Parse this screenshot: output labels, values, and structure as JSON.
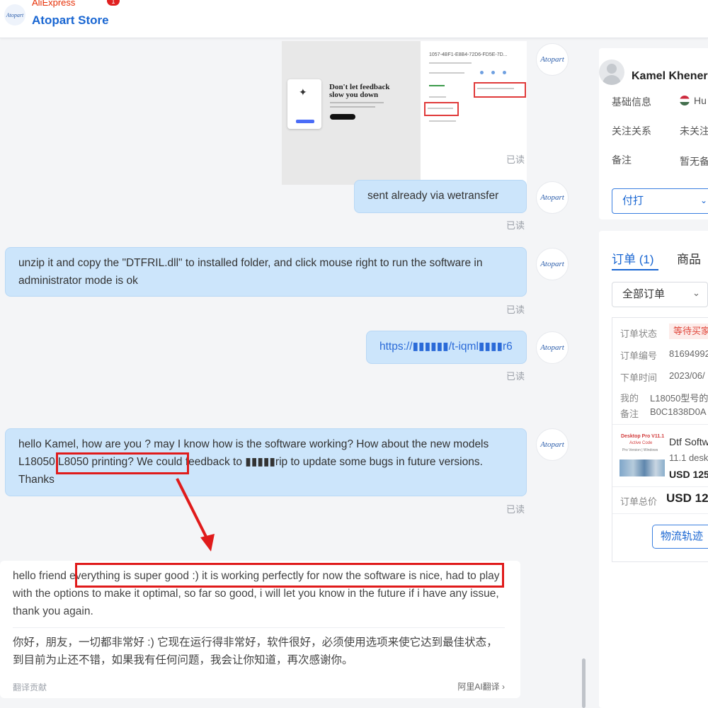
{
  "header": {
    "platform_label": "AliExpress",
    "store_name": "Atopart Store",
    "notification_count": "1",
    "store_logo_text": "Atopart"
  },
  "chat": {
    "agent_avatar_text": "Atopart",
    "read_label": "已读",
    "image_message": {
      "order_id_text": "1057-4BF1-E8B4-72D6-FD5E-7D...",
      "feedback_headline_1": "Don't let feedback",
      "feedback_headline_2": "slow you down"
    },
    "messages": [
      {
        "text": "sent already via wetransfer"
      },
      {
        "text": "unzip it and copy the \"DTFRIL.dll\" to installed folder, and click mouse right to run the software in administrator mode is ok"
      },
      {
        "text": "https://▮▮▮▮▮▮/t-iqml▮▮▮▮r6"
      },
      {
        "text": "hello Kamel, how are you ? may I know how is the software working? How about the new models L18050 L8050 printing? We could feedback to ▮▮▮▮▮rip to update some bugs in future versions. Thanks"
      }
    ],
    "customer_reply": {
      "english": "hello friend everything is super good :) it is working perfectly for now the software is nice, had to play with the options to make it optimal, so far so good, i will let you know in the future if i have any issue, thank you again.",
      "chinese": "你好，朋友，一切都非常好 :) 它现在运行得非常好，软件很好，必须使用选项来使它达到最佳状态，到目前为止还不错，如果我有任何问题，我会让你知道，再次感谢你。",
      "footer_left": "翻译贡献",
      "footer_right": "阿里AI翻译 ›"
    }
  },
  "sidebar": {
    "customer_name": "Kamel Khener",
    "basic_info_label": "基础信息",
    "basic_info_value": "Hu",
    "follow_label": "关注关系",
    "follow_value": "未关注",
    "note_label": "备注",
    "note_value": "暂无备",
    "payment_select": "付打",
    "tabs": [
      {
        "label": "订单 (1)"
      },
      {
        "label": "商品"
      }
    ],
    "order_filter": "全部订单",
    "order": {
      "status_label": "订单状态",
      "status_value": "等待买家",
      "number_label": "订单编号",
      "number_value": "81694992",
      "time_label": "下单时间",
      "time_value": "2023/06/",
      "my_label": "我的",
      "remark_label": "备注",
      "remark_value_1": "L18050型号的",
      "remark_value_2": "B0C1838D0A",
      "product_thumb_title": "Desktop Pro V11.1",
      "product_thumb_sub": "Active Code",
      "product_thumb_small": "Pro Version | Windows",
      "product_name": "Dtf Software",
      "product_detail": "11.1 desk",
      "product_price": "USD 125",
      "total_label": "订单总价",
      "total_value": "USD 12",
      "logistics_button": "物流轨迹"
    }
  },
  "colors": {
    "bubble": "#cce5fb",
    "brand_blue": "#1966d2",
    "annotation_red": "#e01b1b"
  }
}
